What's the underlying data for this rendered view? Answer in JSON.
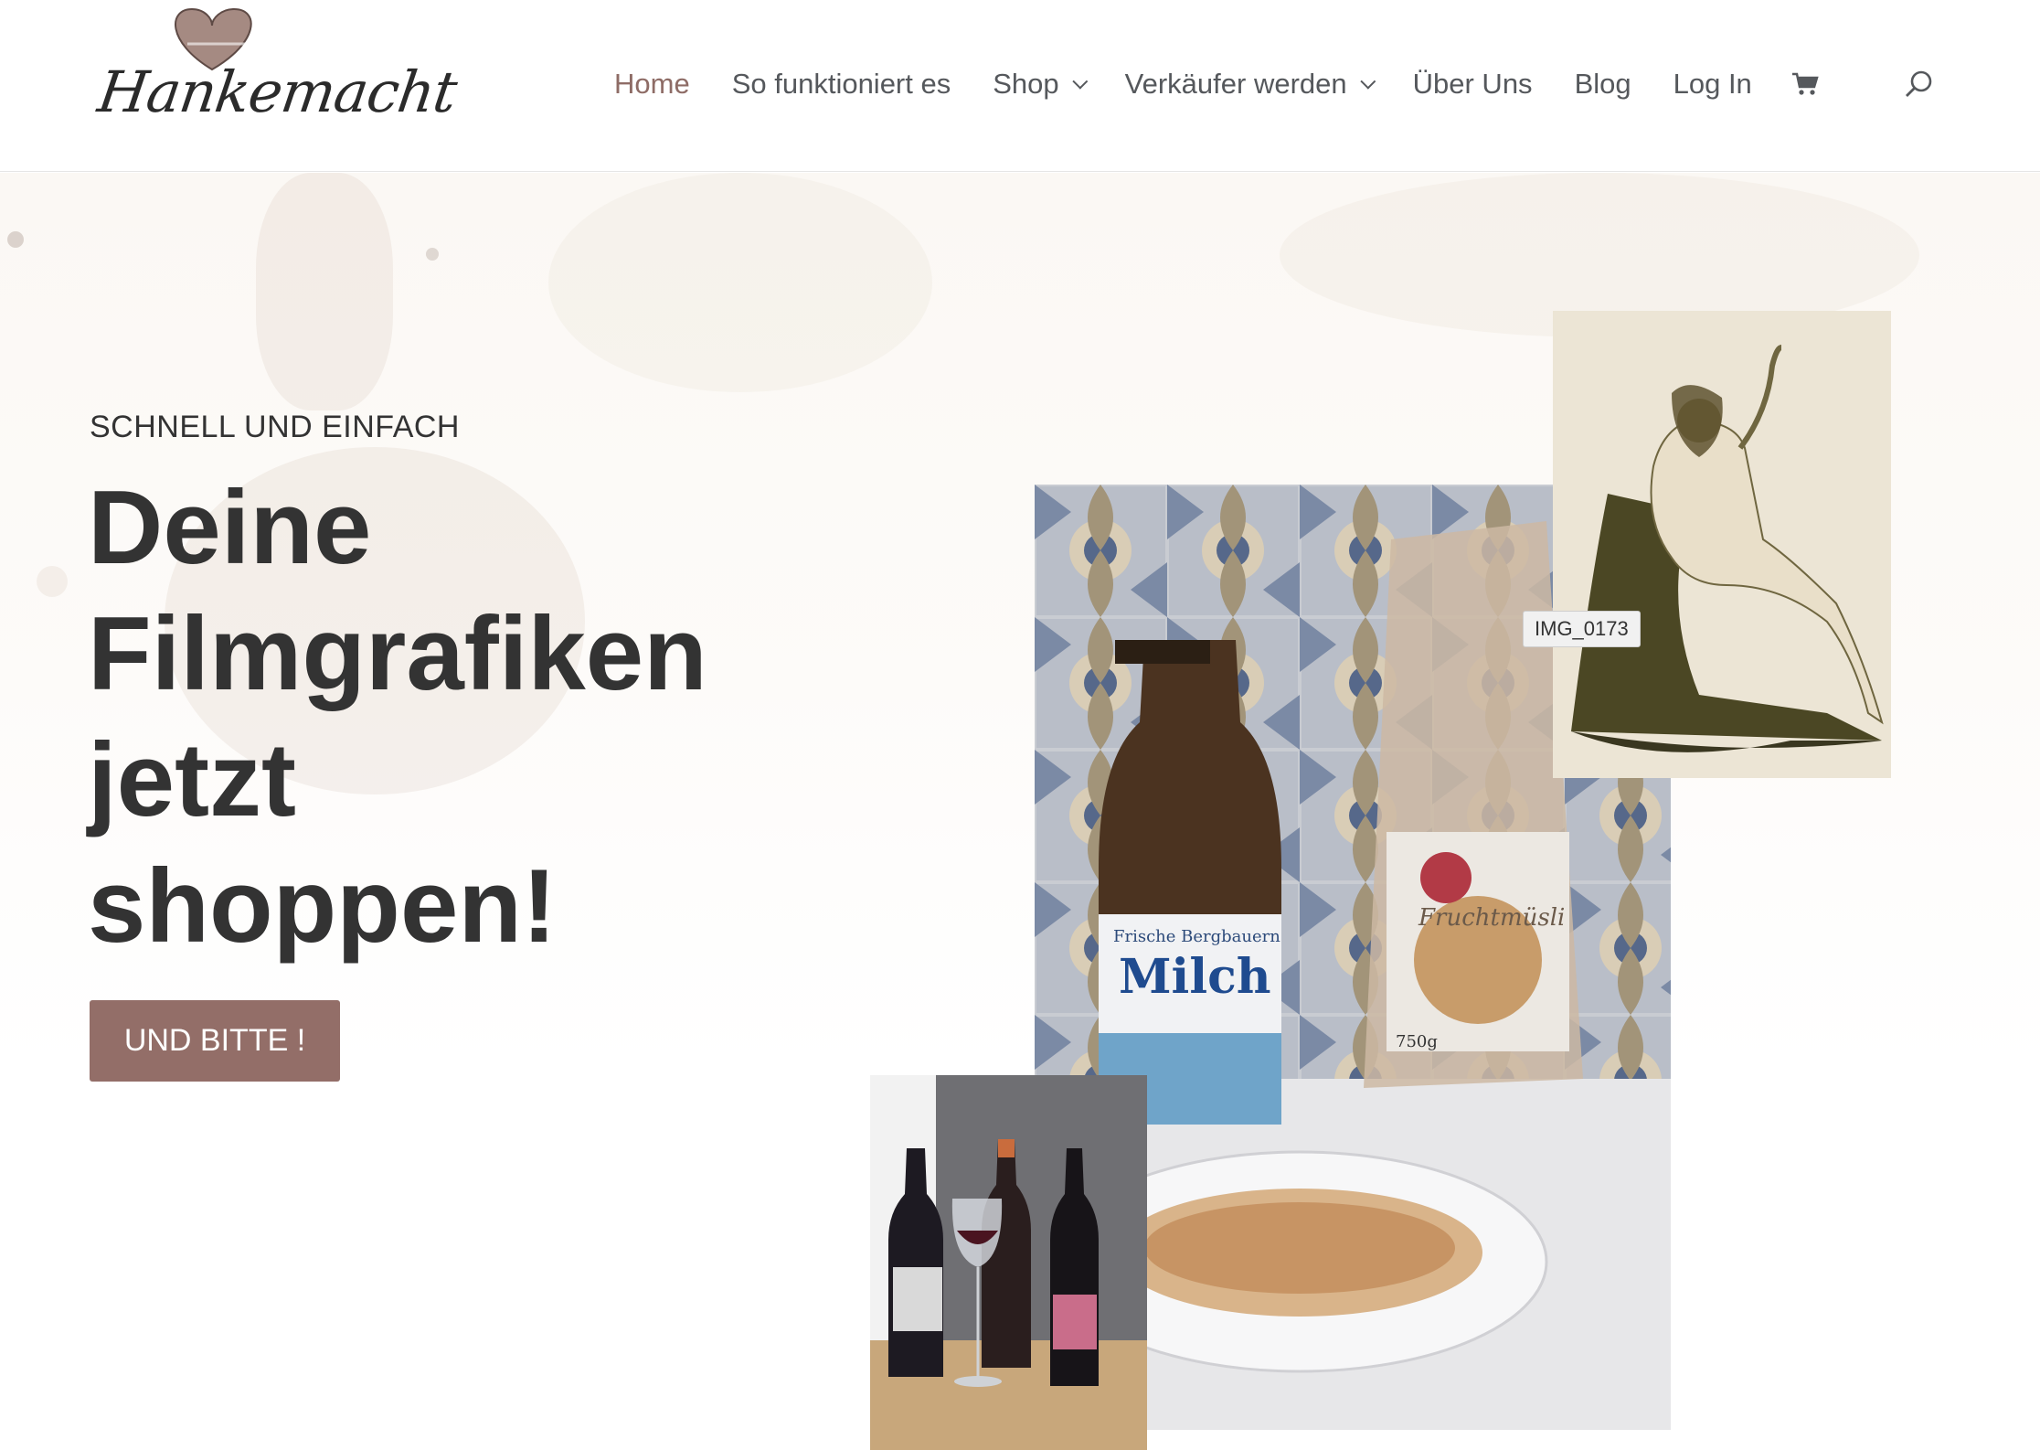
{
  "header": {
    "logo_text": "Hankemacht",
    "nav": [
      {
        "label": "Home",
        "active": true,
        "dropdown": false
      },
      {
        "label": "So funktioniert es",
        "active": false,
        "dropdown": false
      },
      {
        "label": "Shop",
        "active": false,
        "dropdown": true
      },
      {
        "label": "Verkäufer werden",
        "active": false,
        "dropdown": true
      },
      {
        "label": "Über Uns",
        "active": false,
        "dropdown": false
      },
      {
        "label": "Blog",
        "active": false,
        "dropdown": false
      },
      {
        "label": "Log In",
        "active": false,
        "dropdown": false
      }
    ],
    "icons": [
      "cart-icon",
      "search-icon"
    ]
  },
  "hero": {
    "eyebrow": "SCHNELL UND EINFACH",
    "headline_lines": [
      "Deine",
      "Filmgrafiken",
      "jetzt",
      "shoppen!"
    ],
    "cta_label": "UND BITTE !",
    "images": {
      "milk_label_small": "Frische Bergbauern",
      "milk_label_big": "Milch",
      "muesli_label": "Fruchtmüsli",
      "muesli_weight": "750g",
      "drawing_tooltip": "IMG_0173"
    }
  },
  "colors": {
    "accent": "#936e68",
    "nav_active": "#8e6c66",
    "text": "#333333",
    "nav_text": "#55585c"
  }
}
